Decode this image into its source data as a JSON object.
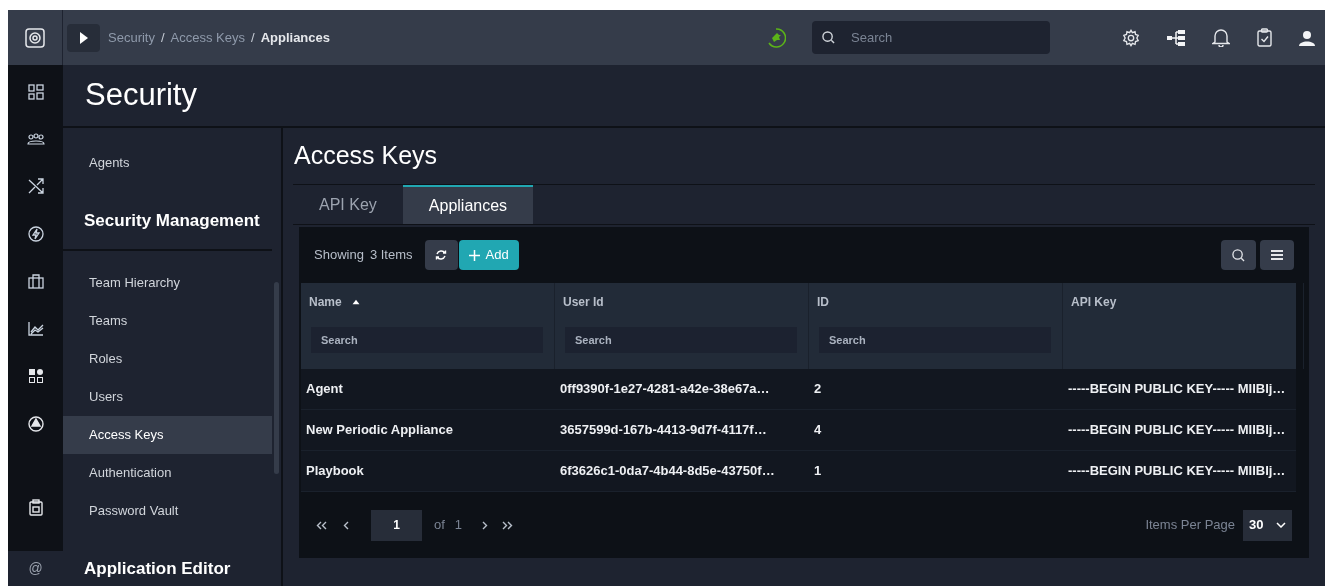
{
  "topbar": {
    "separator": "/",
    "breadcrumbs": [
      {
        "label": "Security",
        "current": false
      },
      {
        "label": "Access Keys",
        "current": false
      },
      {
        "label": "Appliances",
        "current": true
      }
    ],
    "search": {
      "placeholder": "Search"
    }
  },
  "rail": {
    "footer": "@"
  },
  "page_title": "Security",
  "sidebar": {
    "items": [
      {
        "kind": "link",
        "label": "Agents",
        "selected": false
      },
      {
        "kind": "heading",
        "label": "Security Management"
      },
      {
        "kind": "link",
        "label": "Team Hierarchy",
        "selected": false
      },
      {
        "kind": "link",
        "label": "Teams",
        "selected": false
      },
      {
        "kind": "link",
        "label": "Roles",
        "selected": false
      },
      {
        "kind": "link",
        "label": "Users",
        "selected": false
      },
      {
        "kind": "link",
        "label": "Access Keys",
        "selected": true
      },
      {
        "kind": "link",
        "label": "Authentication",
        "selected": false
      },
      {
        "kind": "link",
        "label": "Password Vault",
        "selected": false
      },
      {
        "kind": "heading",
        "label": "Application Editor"
      }
    ]
  },
  "main": {
    "title": "Access Keys",
    "tabs": [
      {
        "label": "API Key",
        "selected": false
      },
      {
        "label": "Appliances",
        "selected": true
      }
    ],
    "toolbar": {
      "showing": "Showing",
      "count": "3 Items",
      "add": "Add"
    },
    "table": {
      "columns": [
        {
          "label": "Name",
          "sorted": true,
          "filter_placeholder": "Search"
        },
        {
          "label": "User Id",
          "sorted": false,
          "filter_placeholder": "Search"
        },
        {
          "label": "ID",
          "sorted": false,
          "filter_placeholder": "Search"
        },
        {
          "label": "API Key",
          "sorted": false
        }
      ],
      "rows": [
        [
          "Agent",
          "0ff9390f-1e27-4281-a42e-38e67a…",
          "2",
          "-----BEGIN PUBLIC KEY----- MIIBIj…"
        ],
        [
          "New Periodic Appliance",
          "3657599d-167b-4413-9d7f-4117f…",
          "4",
          "-----BEGIN PUBLIC KEY----- MIIBIj…"
        ],
        [
          "Playbook",
          "6f3626c1-0da7-4b44-8d5e-43750f…",
          "1",
          "-----BEGIN PUBLIC KEY----- MIIBIj…"
        ]
      ]
    },
    "pagination": {
      "page": "1",
      "of": "of",
      "total": "1",
      "per_page_label": "Items Per Page",
      "per_page": "30"
    }
  }
}
